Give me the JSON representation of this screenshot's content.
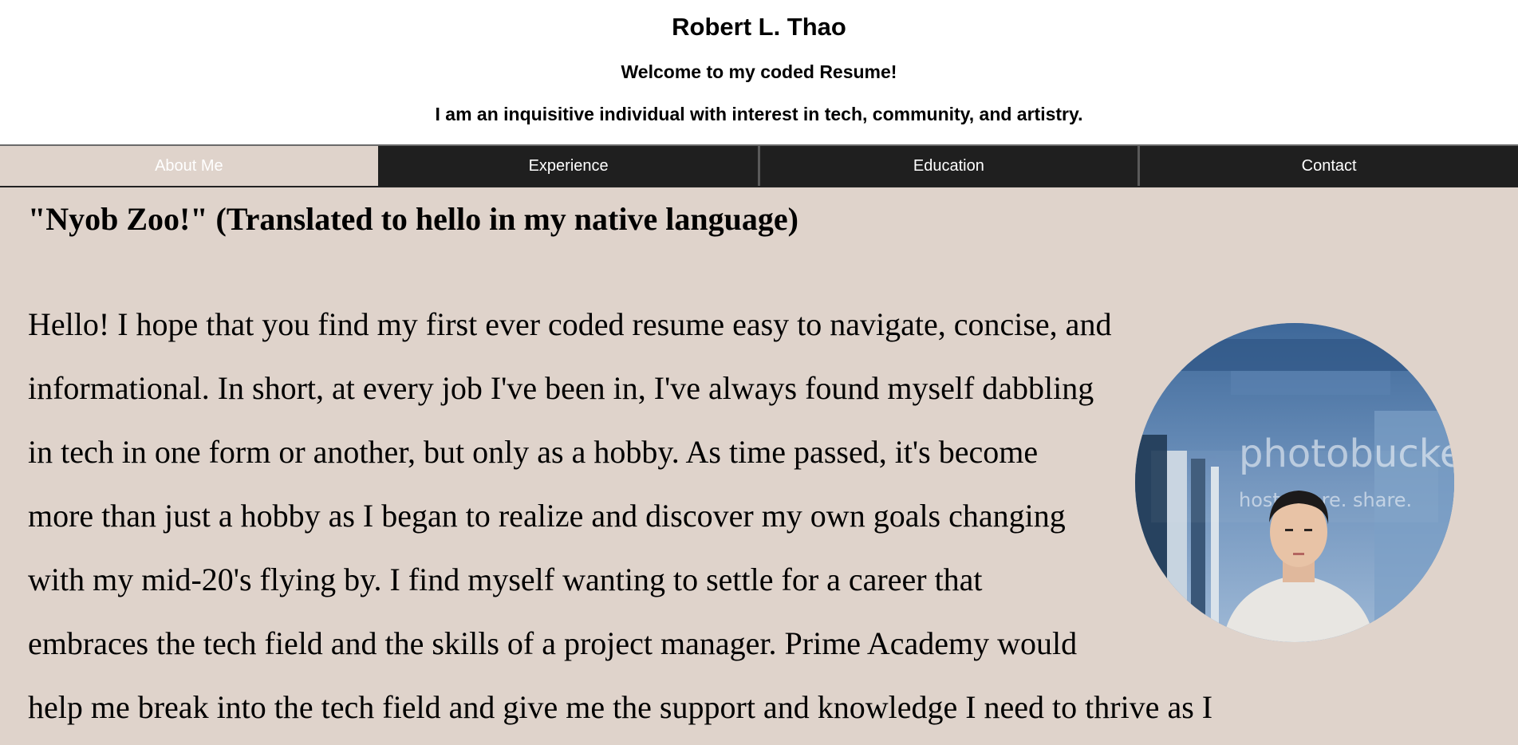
{
  "header": {
    "name": "Robert L. Thao",
    "welcome": "Welcome to my coded Resume!",
    "tagline": "I am an inquisitive individual with interest in tech, community, and artistry."
  },
  "nav": {
    "tabs": [
      {
        "label": "About Me",
        "active": true
      },
      {
        "label": "Experience",
        "active": false
      },
      {
        "label": "Education",
        "active": false
      },
      {
        "label": "Contact",
        "active": false
      }
    ]
  },
  "about": {
    "heading": "\"Nyob Zoo!\" (Translated to hello in my native language)",
    "lines": [
      "Hello! I hope that you find my first ever coded resume easy to navigate, concise, and",
      "informational. In short, at every job I've been in, I've always found myself dabbling",
      "in tech in one form or another, but only as a hobby. As time passed, it's become",
      "more than just a hobby as I began to realize and discover my own goals changing",
      "with my mid-20's flying by. I find myself wanting to settle for a career that",
      "embraces the tech field and the skills of a project manager. Prime Academy would",
      "help me break into the tech field and give me the support and knowledge I need to thrive as I"
    ],
    "photo": {
      "watermark_main": "photobucket",
      "watermark_sub": "host. store. share."
    }
  },
  "colors": {
    "background": "#dfd3cb",
    "nav": "#1f1f1f"
  }
}
